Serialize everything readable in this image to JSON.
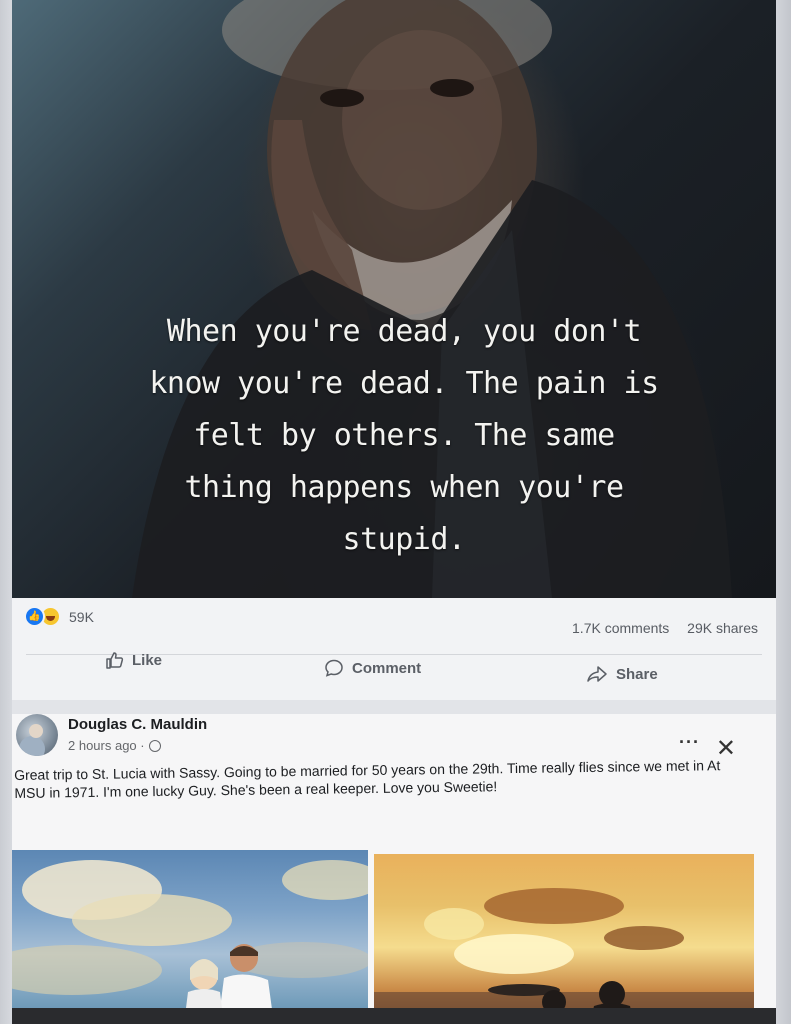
{
  "post1": {
    "quote_lines": [
      "When you're dead, you don't",
      "know you're dead. The pain is",
      "felt by others. The same",
      "thing happens when you're",
      "stupid."
    ],
    "reaction_count": "59K",
    "comments": "1.7K comments",
    "shares": "29K shares",
    "actions": {
      "like": "Like",
      "comment": "Comment",
      "share": "Share"
    }
  },
  "post2": {
    "author": "Douglas C. Mauldin",
    "time": "2 hours ago ·",
    "more": "···",
    "close": "✕",
    "caption": "Great trip to St. Lucia with Sassy. Going to be married for 50 years on the 29th. Time really flies since we met in At MSU in 1971. I'm one lucky Guy. She's been a real keeper. Love you Sweetie!"
  },
  "colors": {
    "like_blue": "#1877f2",
    "haha_yellow": "#f7c62f",
    "muted_text": "#65676b"
  },
  "icons": [
    "like-reaction-icon",
    "haha-reaction-icon",
    "thumbs-up-icon",
    "comment-icon",
    "share-icon",
    "globe-icon",
    "more-icon",
    "close-icon"
  ]
}
